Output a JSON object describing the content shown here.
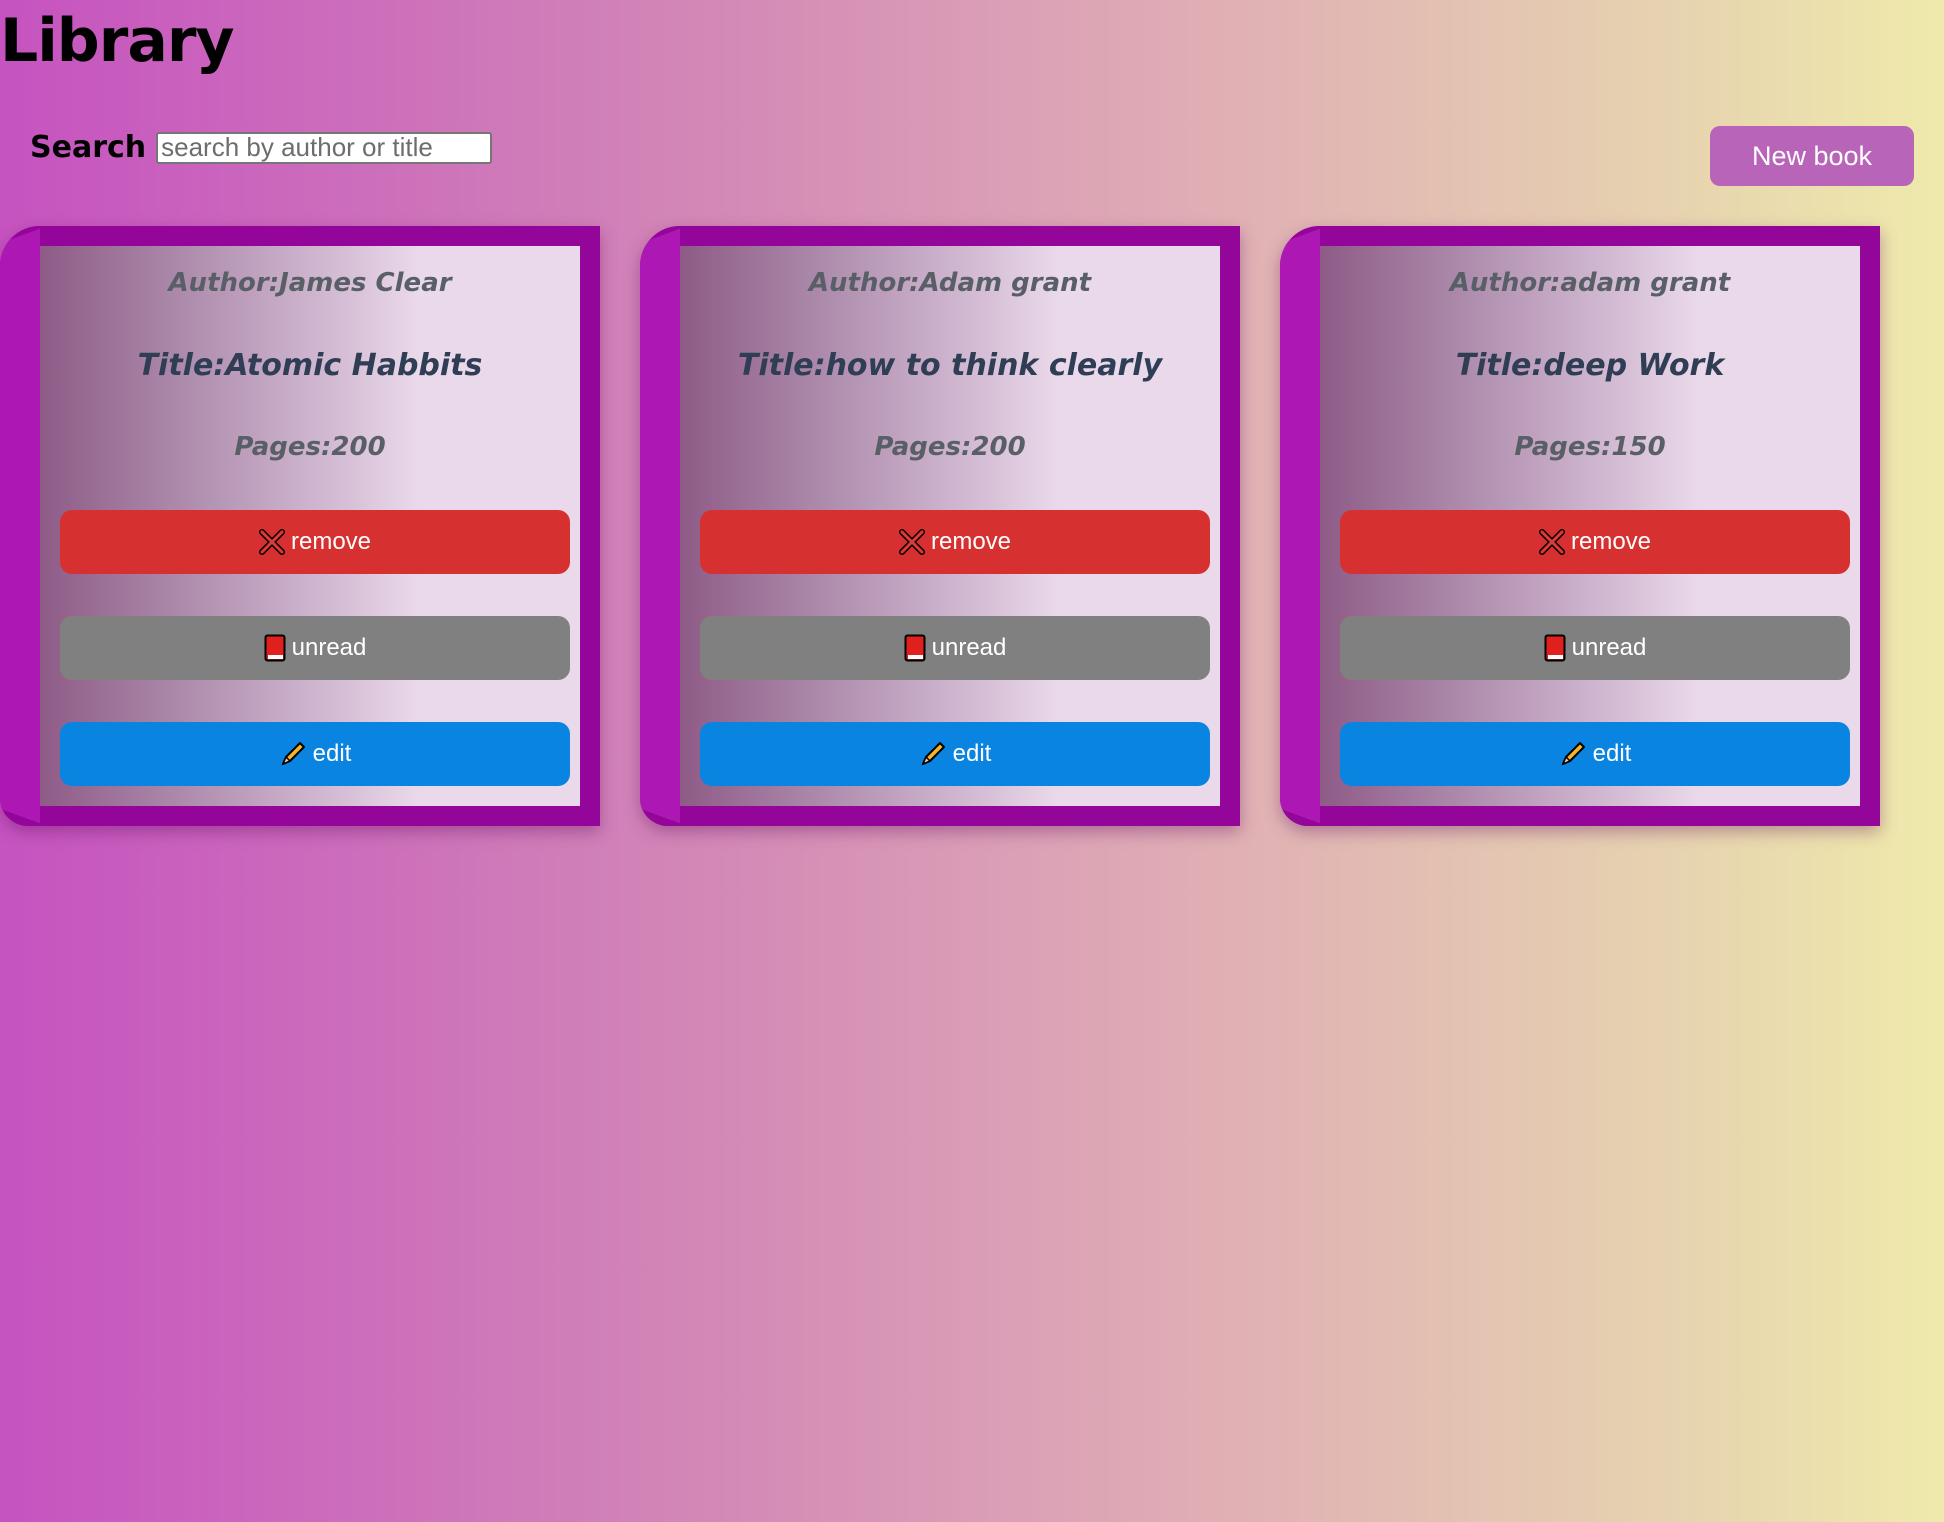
{
  "header": {
    "title": "Library"
  },
  "search": {
    "label": "Search",
    "placeholder": "search by author or title"
  },
  "toolbar": {
    "new_book_label": "New book"
  },
  "colors": {
    "card_border": "#94059a",
    "remove_button": "#d63031",
    "unread_button": "#808080",
    "edit_button": "#0a84e1",
    "new_book_button": "#b865b9"
  },
  "books": [
    {
      "author": "Author:James Clear",
      "title": "Title:Atomic Habbits",
      "pages": "Pages:200",
      "remove_label": "remove",
      "status_label": "unread",
      "edit_label": "edit",
      "icons": {
        "remove": "cross-mark-icon",
        "status": "red-book-icon",
        "edit": "pencil-icon"
      }
    },
    {
      "author": "Author:Adam grant",
      "title": "Title:how to think clearly",
      "pages": "Pages:200",
      "remove_label": "remove",
      "status_label": "unread",
      "edit_label": "edit",
      "icons": {
        "remove": "cross-mark-icon",
        "status": "red-book-icon",
        "edit": "pencil-icon"
      }
    },
    {
      "author": "Author:adam grant",
      "title": "Title:deep Work",
      "pages": "Pages:150",
      "remove_label": "remove",
      "status_label": "unread",
      "edit_label": "edit",
      "icons": {
        "remove": "cross-mark-icon",
        "status": "red-book-icon",
        "edit": "pencil-icon"
      }
    }
  ]
}
